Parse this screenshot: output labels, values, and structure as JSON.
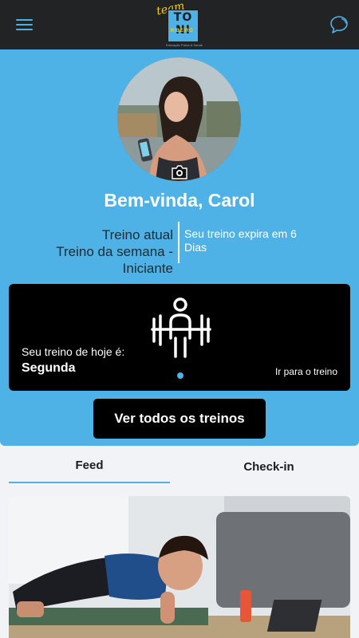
{
  "header": {
    "logo": {
      "script": "team",
      "line1": "TO",
      "line2": "NI",
      "name": "RIBEIRO",
      "tagline": "Educação Física & Saúde"
    },
    "menu_icon": "hamburger-menu-icon",
    "chat_icon": "chat-bubble-icon"
  },
  "profile": {
    "greeting": "Bem-vinda, Carol",
    "camera_icon": "camera-icon"
  },
  "plan": {
    "current_label": "Treino atual",
    "current_name": "Treino da semana - Iniciante",
    "expiry_text": "Seu treino expira em 6 Dias"
  },
  "workout_card": {
    "icon": "weightlifter-icon",
    "today_label": "Seu treino de hoje é:",
    "day": "Segunda",
    "go_link": "Ir para o treino",
    "page_indicator": {
      "current": 1,
      "total": 1
    }
  },
  "all_workouts_button": "Ver todos os treinos",
  "tabs": [
    {
      "label": "Feed",
      "active": true
    },
    {
      "label": "Check-in",
      "active": false
    }
  ],
  "colors": {
    "accent": "#4fb2e6",
    "topbar": "#222324",
    "card": "#000000",
    "logo_yellow": "#f5d300"
  }
}
